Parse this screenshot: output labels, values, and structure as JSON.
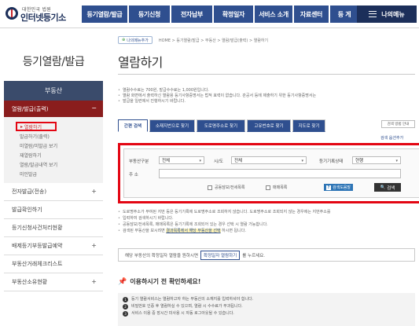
{
  "header": {
    "logo_small": "대한민국 법원",
    "logo_big": "인터넷등기소",
    "gnb": [
      "등기열람/발급",
      "등기신청",
      "전자납부",
      "확정일자",
      "서비스 소개",
      "자료센터",
      "등 게"
    ],
    "my_menu": "나의메뉴"
  },
  "sidebar": {
    "title": "등기열람/발급",
    "section": "부동산",
    "group": "열람/발급(출력)",
    "group_toggle": "−",
    "sub_items": [
      "열람하기",
      "발급하기(출력)",
      "미열람/미발급 보기",
      "재열람하기",
      "열람/발급내역 보기",
      "미인발급"
    ],
    "rows": [
      {
        "label": "전자발급(전송)",
        "toggle": "+"
      },
      {
        "label": "발급확인하기",
        "toggle": ""
      },
      {
        "label": "등기신청사건처리현황",
        "toggle": ""
      },
      {
        "label": "배제등기부등발급예약",
        "toggle": "+"
      },
      {
        "label": "부동산거래체크리스트",
        "toggle": ""
      },
      {
        "label": "부동산소유현황",
        "toggle": "+"
      }
    ]
  },
  "breadcrumb": {
    "add_label": "나의메뉴추가",
    "path": "HOME > 등기열람/발급 > 부동산 > 열람/발급(출력) > 열람하기"
  },
  "page_title": "열람하기",
  "notes": [
    "열람수수료는 700원, 발급수수료는 1,000원입니다.",
    "열람 화면에서 출력하신 열람용 등기사항증명서는 법적 효력이 없습니다. 관공서 등에 제출하기 위한 등기사항증명서는",
    "발급을 일련에서 진행하시기 바랍니다."
  ],
  "tabs": [
    "간편 검색",
    "소재지번으로 찾기",
    "도로명주소로 찾기",
    "고유번호로 찾기",
    "지도로 찾기"
  ],
  "tab_help": "검색 방법 안내",
  "search_option": "검색 옵션추가",
  "form": {
    "realty_type_label": "부동산구분",
    "realty_type_value": "전체",
    "region_label": "시/도",
    "region_value": "전체",
    "status_label": "등기기록상태",
    "status_value": "현행",
    "address_label": "주 소",
    "address_placeholder": "",
    "check_shared": "공동담보/전세목록",
    "check_history": "매매목록",
    "help_label": "검색도움말",
    "search_button": "검색"
  },
  "info": {
    "line1": "도로명주소가 부여된 지번 등은 등기기록에 도로명주소로 조회하지 않습니다. 도로명주소로 조회되지 않는 경우에는 지번주소를",
    "line1b": "입력하여 검색하시기 바랍니다.",
    "line2": "공동담보/전세목록, 매매목록은 등기기록에 조회되어 있는 경우 선택 시 열람 가능합니다.",
    "line3_pre": "검색된 부동산을 보시려면",
    "line3_link": "결과목록에서 해당 부동산을 선택",
    "line3_post": "하시면 됩니다."
  },
  "message": {
    "pre": "해당 부동산의 확정일자 열람을 원하시면",
    "button": "확정일자 열람하기",
    "post": "를 누르세요."
  },
  "checklist": {
    "title": "이용하시기 전 확인하세요!",
    "items": [
      "등기 열람서비스는 열람하고자 하는 부동산의 소재지를 입력하셔야 합니다.",
      "비밀번호 인증 후 열람하실 수 있으며, 열람 시 수수료가 부과됩니다.",
      "서비스 이용 중 장시간 미사용 시 자동 로그아웃될 수 있습니다."
    ]
  },
  "colors": {
    "nav_blue": "#2f4f8f",
    "navy": "#1c2f5a",
    "sidebar_group": "#8a1d1d",
    "highlight_red": "#e30613"
  }
}
